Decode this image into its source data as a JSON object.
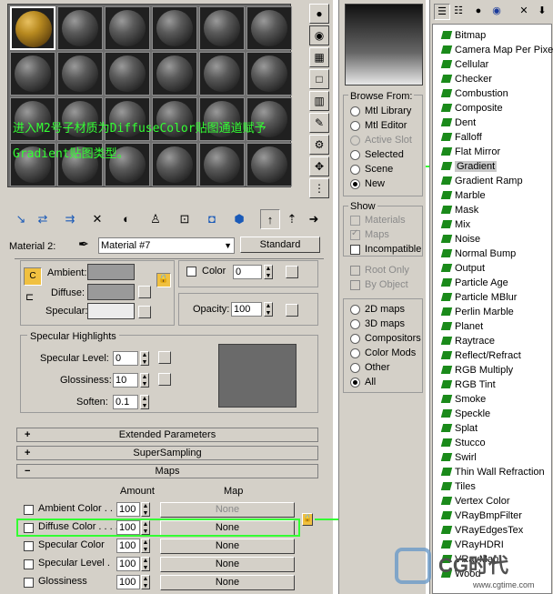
{
  "overlay": {
    "line1": "进入M2号子材质为DiffuseColor贴图通道赋予",
    "line2": "Gradient贴图类型。"
  },
  "material_editor": {
    "material_label": "Material 2:",
    "material_name": "Material #7",
    "type_button": "Standard",
    "basic": {
      "ambient_label": "Ambient:",
      "diffuse_label": "Diffuse:",
      "specular_label": "Specular:",
      "color_label": "Color",
      "color_value": "0",
      "opacity_label": "Opacity:",
      "opacity_value": "100"
    },
    "specular_highlights": {
      "title": "Specular Highlights",
      "level_label": "Specular Level:",
      "level_value": "0",
      "gloss_label": "Glossiness:",
      "gloss_value": "10",
      "soften_label": "Soften:",
      "soften_value": "0.1"
    },
    "rollouts": [
      {
        "sign": "+",
        "label": "Extended Parameters"
      },
      {
        "sign": "+",
        "label": "SuperSampling"
      },
      {
        "sign": "−",
        "label": "Maps"
      }
    ],
    "maps": {
      "amount_header": "Amount",
      "map_header": "Map",
      "rows": [
        {
          "label": "Ambient Color . .",
          "amount": "100",
          "map": "None"
        },
        {
          "label": "Diffuse Color . . . .",
          "amount": "100",
          "map": "None"
        },
        {
          "label": "Specular Color",
          "amount": "100",
          "map": "None"
        },
        {
          "label": "Specular Level .",
          "amount": "100",
          "map": "None"
        },
        {
          "label": "Glossiness",
          "amount": "100",
          "map": "None"
        }
      ]
    }
  },
  "browser": {
    "browse_from_title": "Browse From:",
    "browse_from": [
      {
        "label": "Mtl Library",
        "selected": false,
        "disabled": false
      },
      {
        "label": "Mtl Editor",
        "selected": false,
        "disabled": false
      },
      {
        "label": "Active Slot",
        "selected": false,
        "disabled": true
      },
      {
        "label": "Selected",
        "selected": false,
        "disabled": false
      },
      {
        "label": "Scene",
        "selected": false,
        "disabled": false
      },
      {
        "label": "New",
        "selected": true,
        "disabled": false
      }
    ],
    "show_title": "Show",
    "show": [
      {
        "label": "Materials",
        "disabled": true
      },
      {
        "label": "Maps",
        "disabled": true
      },
      {
        "label": "Incompatible",
        "disabled": false
      }
    ],
    "root_only": "Root Only",
    "by_object": "By Object",
    "map_types": [
      {
        "label": "2D maps",
        "selected": false
      },
      {
        "label": "3D maps",
        "selected": false
      },
      {
        "label": "Compositors",
        "selected": false
      },
      {
        "label": "Color Mods",
        "selected": false
      },
      {
        "label": "Other",
        "selected": false
      },
      {
        "label": "All",
        "selected": true
      }
    ]
  },
  "map_list": {
    "items": [
      "Bitmap",
      "Camera Map Per Pixel",
      "Cellular",
      "Checker",
      "Combustion",
      "Composite",
      "Dent",
      "Falloff",
      "Flat Mirror",
      "Gradient",
      "Gradient Ramp",
      "Marble",
      "Mask",
      "Mix",
      "Noise",
      "Normal Bump",
      "Output",
      "Particle Age",
      "Particle MBlur",
      "Perlin Marble",
      "Planet",
      "Raytrace",
      "Reflect/Refract",
      "RGB Multiply",
      "RGB Tint",
      "Smoke",
      "Speckle",
      "Splat",
      "Stucco",
      "Swirl",
      "Thin Wall Refraction",
      "Tiles",
      "Vertex Color",
      "VRayBmpFilter",
      "VRayEdgesTex",
      "VRayHDRI",
      "VRayMap",
      "Wood"
    ],
    "selected": "Gradient"
  },
  "watermark": {
    "brand": "CG时代",
    "url": "www.cgtime.com"
  },
  "colors": {
    "highlight_green": "#33ff33",
    "panel_gray": "#d4d0c8"
  }
}
